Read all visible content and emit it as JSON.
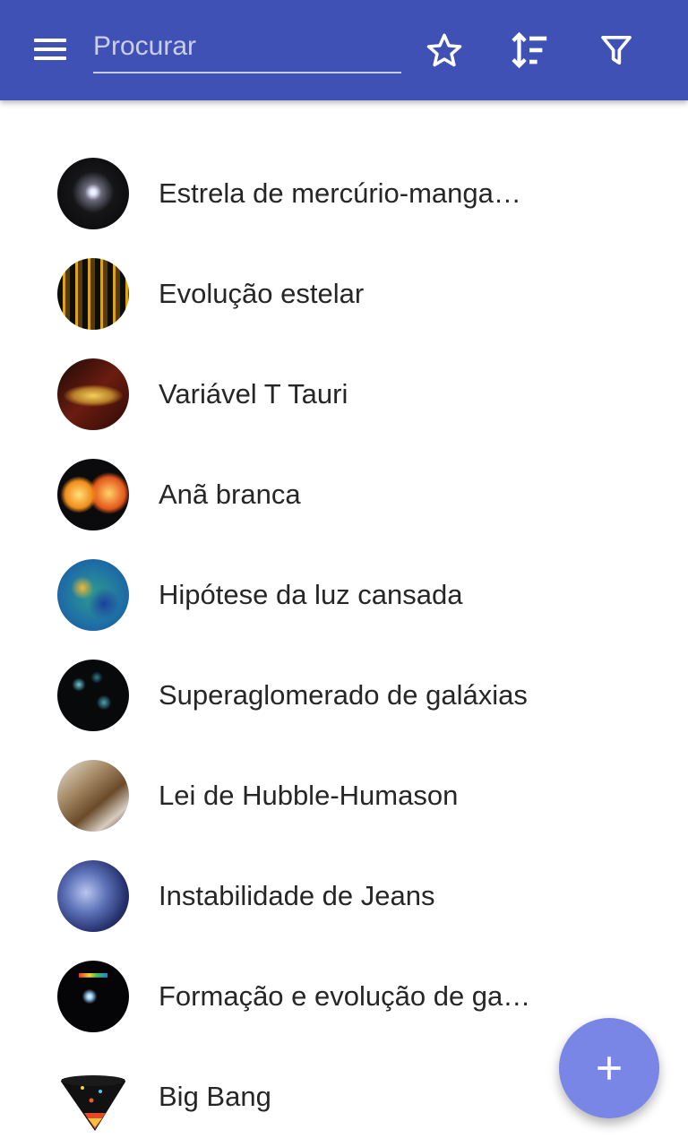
{
  "appbar": {
    "bg_color": "#3f51b5",
    "menu_icon": "menu-icon",
    "search_placeholder": "Procurar",
    "actions": [
      "star-icon",
      "sort-icon",
      "filter-icon"
    ]
  },
  "list": {
    "items": [
      {
        "label": "Estrela de mercúrio-manganês"
      },
      {
        "label": "Evolução estelar"
      },
      {
        "label": "Variável T Tauri"
      },
      {
        "label": "Anã branca"
      },
      {
        "label": "Hipótese da luz cansada"
      },
      {
        "label": "Superaglomerado de galáxias"
      },
      {
        "label": "Lei de Hubble-Humason"
      },
      {
        "label": "Instabilidade de Jeans"
      },
      {
        "label": "Formação e evolução de galáxias"
      },
      {
        "label": "Big Bang"
      }
    ]
  },
  "fab": {
    "icon": "plus-icon",
    "color": "#7986e6"
  }
}
